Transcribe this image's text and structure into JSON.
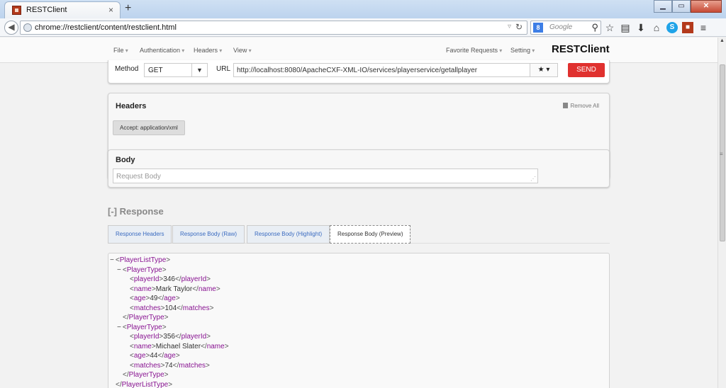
{
  "browser": {
    "tab_title": "RESTClient",
    "tab_close": "×",
    "new_tab": "+",
    "address": "chrome://restclient/content/restclient.html",
    "search_engine_letter": "8",
    "search_placeholder": "Google",
    "window_buttons": {
      "minimize": "▁",
      "maximize": "▭",
      "close": "✕"
    }
  },
  "app": {
    "menu": {
      "file": "File",
      "authentication": "Authentication",
      "headers": "Headers",
      "view": "View",
      "favorite_requests": "Favorite Requests",
      "setting": "Setting"
    },
    "brand": "RESTClient",
    "request": {
      "method_label": "Method",
      "method_value": "GET",
      "url_label": "URL",
      "url_value": "http://localhost:8080/ApacheCXF-XML-IO/services/playerservice/getallplayer",
      "send_label": "SEND"
    },
    "headers_panel": {
      "title": "Headers",
      "remove_all": "Remove All",
      "items": [
        "Accept: application/xml"
      ]
    },
    "body_panel": {
      "title": "Body",
      "placeholder": "Request Body"
    },
    "response": {
      "title": "[-] Response",
      "tabs": [
        "Response Headers",
        "Response Body (Raw)",
        "Response Body (Highlight)",
        "Response Body (Preview)"
      ],
      "active_tab": 3,
      "xml_lines": [
        {
          "toggle": "−",
          "open": "PlayerListType",
          "text": "",
          "close": ""
        },
        {
          "toggle": "−",
          "open": "PlayerType",
          "text": "",
          "close": ""
        },
        {
          "toggle": "",
          "open": "playerId",
          "text": "346",
          "close": "playerId"
        },
        {
          "toggle": "",
          "open": "name",
          "text": "Mark Taylor",
          "close": "name"
        },
        {
          "toggle": "",
          "open": "age",
          "text": "49",
          "close": "age"
        },
        {
          "toggle": "",
          "open": "matches",
          "text": "104",
          "close": "matches"
        },
        {
          "toggle": "",
          "open": "",
          "text": "",
          "close": "PlayerType"
        },
        {
          "toggle": "−",
          "open": "PlayerType",
          "text": "",
          "close": ""
        },
        {
          "toggle": "",
          "open": "playerId",
          "text": "356",
          "close": "playerId"
        },
        {
          "toggle": "",
          "open": "name",
          "text": "Michael Slater",
          "close": "name"
        },
        {
          "toggle": "",
          "open": "age",
          "text": "44",
          "close": "age"
        },
        {
          "toggle": "",
          "open": "matches",
          "text": "74",
          "close": "matches"
        },
        {
          "toggle": "",
          "open": "",
          "text": "",
          "close": "PlayerType"
        },
        {
          "toggle": "",
          "open": "",
          "text": "",
          "close": "PlayerListType"
        }
      ]
    }
  },
  "colors": {
    "send": "#e0312f",
    "xml_tag": "#881391",
    "tab_link": "#3a6bc0"
  }
}
